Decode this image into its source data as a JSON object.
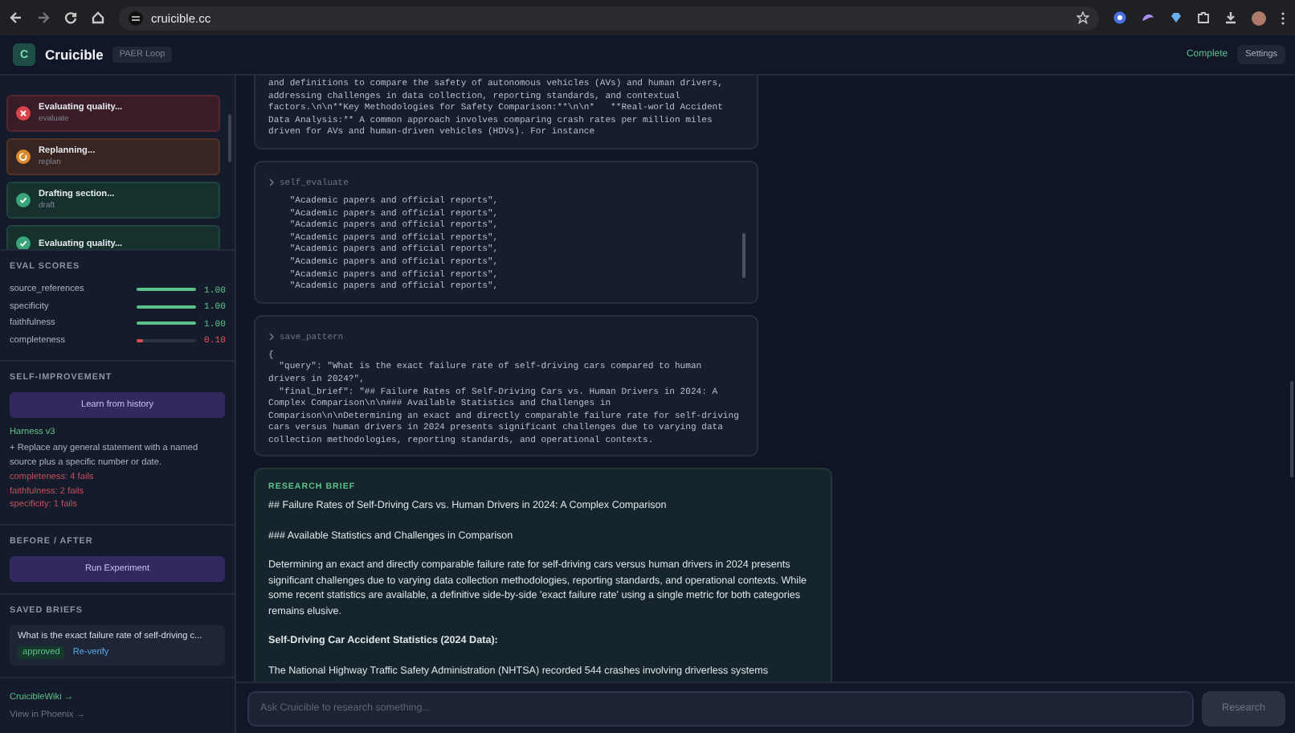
{
  "browser": {
    "url": "cruicible.cc"
  },
  "header": {
    "logo": "C",
    "title": "Cruicible",
    "badge": "PAER Loop",
    "status": "Complete",
    "settings": "Settings"
  },
  "steps": [
    {
      "kind": "fail",
      "title": "Evaluating quality...",
      "subtitle": "evaluate"
    },
    {
      "kind": "replan",
      "title": "Replanning...",
      "subtitle": "replan"
    },
    {
      "kind": "done",
      "title": "Drafting section...",
      "subtitle": "draft"
    },
    {
      "kind": "done",
      "title": "Evaluating quality..."
    }
  ],
  "eval_scores": {
    "title": "EVAL SCORES",
    "metrics": [
      {
        "name": "source_references",
        "level": 1,
        "reading": "1.00"
      },
      {
        "name": "specificity",
        "level": 1,
        "reading": "1.00"
      },
      {
        "name": "faithfulness",
        "level": 1,
        "reading": "1.00"
      },
      {
        "name": "completeness",
        "level": 0.1,
        "reading": "0.10"
      }
    ]
  },
  "self_improvement": {
    "title": "SELF-IMPROVEMENT",
    "button": "Learn from history",
    "harness": "Harness v3",
    "rule": "+ Replace any general statement with a named source plus a specific number or date.",
    "fails": [
      "completeness: 4 fails",
      "faithfulness: 2 fails",
      "specificity: 1 fails"
    ]
  },
  "before_after": {
    "title": "BEFORE / AFTER",
    "button": "Run Experiment"
  },
  "saved_briefs": {
    "title": "SAVED BRIEFS",
    "items": [
      {
        "query": "What is the exact failure rate of self-driving c...",
        "status": "approved",
        "action": "Re-verify"
      }
    ]
  },
  "links": [
    {
      "label": "CruicibleWiki →",
      "kind": "primary"
    },
    {
      "label": "View in Phoenix →",
      "kind": "muted"
    }
  ],
  "tool_cards": [
    {
      "lines": [
        "and definitions to compare the safety of autonomous vehicles (AVs) and human drivers,",
        "addressing challenges in data collection, reporting standards, and contextual",
        "factors.\\n\\n**Key Methodologies for Safety Comparison:**\\n\\n*   **Real-world Accident",
        "Data Analysis:** A common approach involves comparing crash rates per million miles",
        "driven for AVs and human-driven vehicles (HDVs). For instance"
      ]
    },
    {
      "tool": "self_evaluate",
      "scrollable": true,
      "lines": [
        "    \"Academic papers and official reports\",",
        "    \"Academic papers and official reports\",",
        "    \"Academic papers and official reports\",",
        "    \"Academic papers and official reports\",",
        "    \"Academic papers and official reports\",",
        "    \"Academic papers and official reports\",",
        "    \"Academic papers and official reports\",",
        "    \"Academic papers and official reports\","
      ]
    },
    {
      "tool": "save_pattern",
      "lines": [
        "{",
        "  \"query\": \"What is the exact failure rate of self-driving cars compared to human",
        "drivers in 2024?\",",
        "  \"final_brief\": \"## Failure Rates of Self-Driving Cars vs. Human Drivers in 2024: A",
        "Complex Comparison\\n\\n### Available Statistics and Challenges in",
        "Comparison\\n\\nDetermining an exact and directly comparable failure rate for self-driving",
        "cars versus human drivers in 2024 presents significant challenges due to varying data",
        "collection methodologies, reporting standards, and operational contexts."
      ]
    }
  ],
  "brief": {
    "label": "RESEARCH BRIEF",
    "blocks": [
      {
        "kind": "p",
        "text": "## Failure Rates of Self-Driving Cars vs. Human Drivers in 2024: A Complex Comparison"
      },
      {
        "kind": "p",
        "text": "### Available Statistics and Challenges in Comparison"
      },
      {
        "kind": "p",
        "text": "Determining an exact and directly comparable failure rate for self-driving cars versus human drivers in 2024 presents significant challenges due to varying data collection methodologies, reporting standards, and operational contexts. While some recent statistics are available, a definitive side-by-side 'exact failure rate' using a single metric for both categories remains elusive."
      },
      {
        "kind": "strong",
        "text": "Self-Driving Car Accident Statistics (2024 Data):"
      },
      {
        "kind": "p",
        "text": "The National Highway Traffic Safety Administration (NHTSA) recorded 544 crashes involving driverless systems"
      }
    ]
  },
  "composer": {
    "placeholder": "Ask Cruicible to research something...",
    "button": "Research",
    "disabled": true
  }
}
